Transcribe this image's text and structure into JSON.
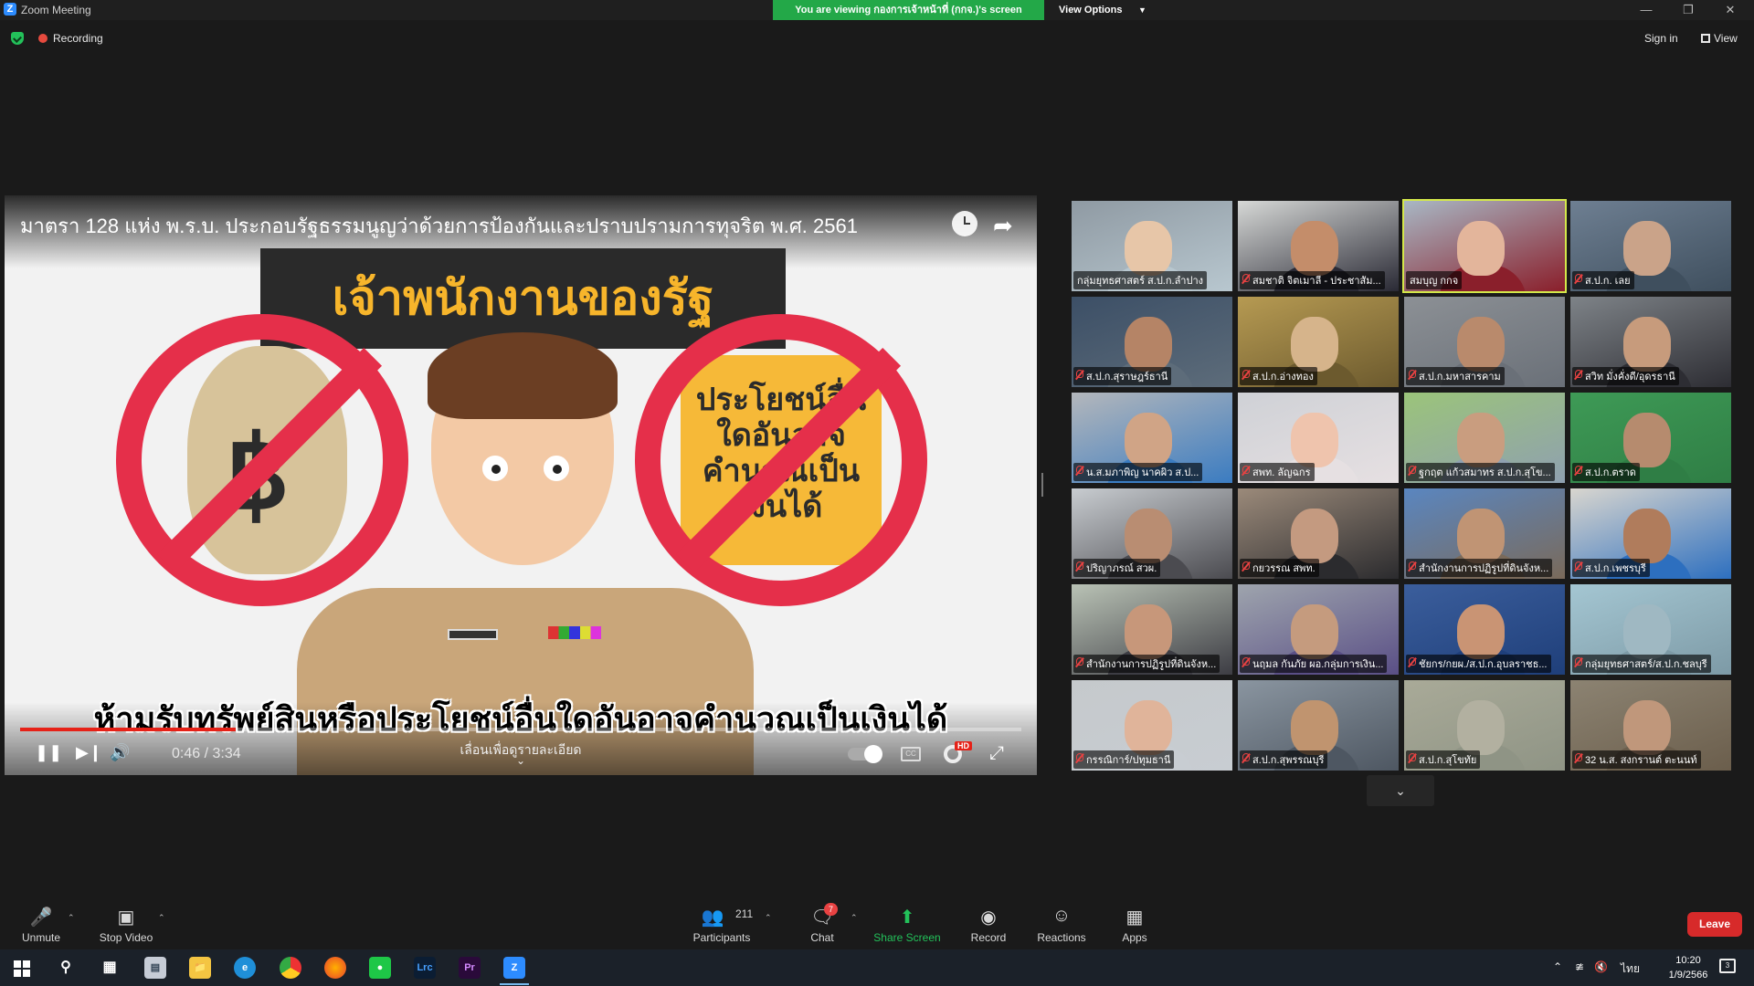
{
  "window": {
    "title": "Zoom Meeting",
    "share_banner": "You are viewing กองการเจ้าหน้าที่ (กกจ.)'s screen",
    "view_options": "View Options",
    "recording": "Recording",
    "sign_in": "Sign in",
    "view": "View"
  },
  "video": {
    "title": "มาตรา 128 แห่ง พ.ร.บ. ประกอบรัฐธรรมนูญว่าด้วยการป้องกันและปราบปรามการทุจริต พ.ศ. 2561",
    "banner": "เจ้าพนักงานของรัฐ",
    "benefit_text": "ประโยชน์อื่นใดอันอาจคำนวณเป็นเงินได้",
    "subtitle": "ห้ามรับทรัพย์สินหรือประโยชน์อื่นใดอันอาจคำนวณเป็นเงินได้",
    "time": "0:46 / 3:34",
    "progress": 0.2149,
    "hint": "เลื่อนเพื่อดูรายละเอียด",
    "hd": "HD",
    "accent": "#e52f4a"
  },
  "gallery": [
    {
      "name": "กลุ่มยุทธศาสตร์ ส.ป.ก.ลำปาง",
      "muted": false,
      "active": false
    },
    {
      "name": "สมชาติ จิตเมาลี - ประชาสัม...",
      "muted": true,
      "active": false
    },
    {
      "name": "สมบุญ กกจ",
      "muted": false,
      "active": true
    },
    {
      "name": "ส.ป.ก. เลย",
      "muted": true,
      "active": false
    },
    {
      "name": "ส.ป.ก.สุราษฎร์ธานี",
      "muted": true,
      "active": false
    },
    {
      "name": "ส.ป.ก.อ่างทอง",
      "muted": true,
      "active": false
    },
    {
      "name": "ส.ป.ก.มหาสารคาม",
      "muted": true,
      "active": false
    },
    {
      "name": "สวิท มั่งคั่งดี/อุดรธานี",
      "muted": true,
      "active": false
    },
    {
      "name": "น.ส.มภาพิญ นาคผิว ส.ป...",
      "muted": true,
      "active": false
    },
    {
      "name": "สพท. ลัญฉกร",
      "muted": true,
      "active": false
    },
    {
      "name": "ฐกฤต แก้วสมาทร ส.ป.ก.สุโข...",
      "muted": true,
      "active": false
    },
    {
      "name": "ส.ป.ก.ตราด",
      "muted": true,
      "active": false
    },
    {
      "name": "ปริญาภรณ์ สวผ.",
      "muted": true,
      "active": false
    },
    {
      "name": "กยวรรณ สพท.",
      "muted": true,
      "active": false
    },
    {
      "name": "สำนักงานการปฏิรูปที่ดินจังห...",
      "muted": true,
      "active": false
    },
    {
      "name": "ส.ป.ก.เพชรบุรี",
      "muted": true,
      "active": false
    },
    {
      "name": "สำนักงานการปฏิรูปที่ดินจังห...",
      "muted": true,
      "active": false
    },
    {
      "name": "นฤมล กันภัย ผอ.กลุ่มการเงิน...",
      "muted": true,
      "active": false
    },
    {
      "name": "ชัยกร/กยผ./ส.ป.ก.อุบลราชธ...",
      "muted": true,
      "active": false
    },
    {
      "name": "กลุ่มยุทธศาสตร์/ส.ป.ก.ชลบุรี",
      "muted": true,
      "active": false
    },
    {
      "name": "กรรณิการ์/ปทุมธานี",
      "muted": true,
      "active": false
    },
    {
      "name": "ส.ป.ก.สุพรรณบุรี",
      "muted": true,
      "active": false
    },
    {
      "name": "ส.ป.ก.สุโขทัย",
      "muted": true,
      "active": false
    },
    {
      "name": "32 น.ส. สงกรานต์ ตะนนท์",
      "muted": true,
      "active": false
    }
  ],
  "toolbar": {
    "unmute": "Unmute",
    "stop_video": "Stop Video",
    "participants": "Participants",
    "participants_count": "211",
    "chat": "Chat",
    "chat_badge": "7",
    "share_screen": "Share Screen",
    "record": "Record",
    "reactions": "Reactions",
    "apps": "Apps",
    "leave": "Leave"
  },
  "taskbar": {
    "apps": [
      "search-icon",
      "task-view-icon",
      "document-icon",
      "file-explorer-icon",
      "edge-icon",
      "chrome-icon",
      "firefox-icon",
      "line-icon",
      "lightroom-icon",
      "premiere-icon",
      "zoom-icon"
    ],
    "lightroom_label": "Lrc",
    "premiere_label": "Pr",
    "language": "ไทย",
    "time": "10:20",
    "date": "1/9/2566",
    "notifications": "3"
  }
}
